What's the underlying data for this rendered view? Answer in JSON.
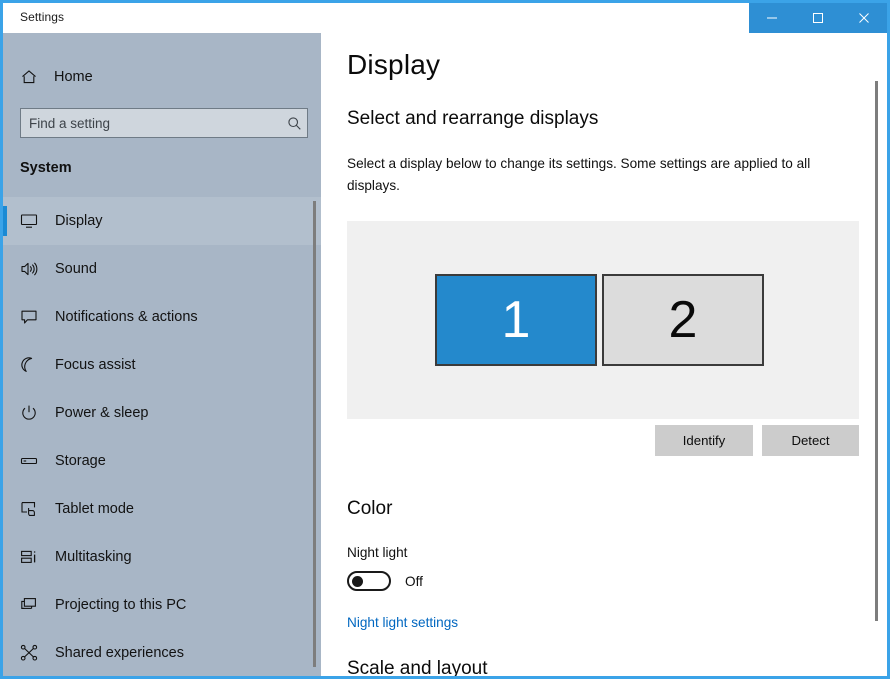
{
  "window": {
    "title": "Settings",
    "accent_color": "#3ba3e8",
    "titlebar_button_bg": "#2e8fd4",
    "controls": [
      {
        "name": "minimize",
        "glyph": "minimize-icon"
      },
      {
        "name": "maximize",
        "glyph": "maximize-icon"
      },
      {
        "name": "close",
        "glyph": "close-icon"
      }
    ]
  },
  "sidebar": {
    "background_color": "#a8b6c6",
    "home": {
      "label": "Home",
      "icon": "home-icon"
    },
    "search": {
      "value": "",
      "placeholder": "Find a setting",
      "icon": "search-icon"
    },
    "section_title": "System",
    "selected_index": 0,
    "selection_color": "#1b8ad4",
    "items": [
      {
        "label": "Display",
        "icon": "monitor-icon",
        "selected": true
      },
      {
        "label": "Sound",
        "icon": "speaker-icon",
        "selected": false
      },
      {
        "label": "Notifications & actions",
        "icon": "notification-icon",
        "selected": false
      },
      {
        "label": "Focus assist",
        "icon": "moon-icon",
        "selected": false
      },
      {
        "label": "Power & sleep",
        "icon": "power-icon",
        "selected": false
      },
      {
        "label": "Storage",
        "icon": "drive-icon",
        "selected": false
      },
      {
        "label": "Tablet mode",
        "icon": "tablet-icon",
        "selected": false
      },
      {
        "label": "Multitasking",
        "icon": "multitasking-icon",
        "selected": false
      },
      {
        "label": "Projecting to this PC",
        "icon": "projecting-icon",
        "selected": false
      },
      {
        "label": "Shared experiences",
        "icon": "share-icon",
        "selected": false
      }
    ]
  },
  "main": {
    "page_title": "Display",
    "section_select": {
      "heading": "Select and rearrange displays",
      "description": "Select a display below to change its settings. Some settings are applied to all displays.",
      "canvas_bg": "#f0f0f0",
      "displays": [
        {
          "number": "1",
          "selected": true,
          "fill": "#2489cc",
          "text_color": "#ffffff"
        },
        {
          "number": "2",
          "selected": false,
          "fill": "#dcdcdc",
          "text_color": "#0a0a0a"
        }
      ],
      "buttons": [
        {
          "label": "Identify",
          "name": "identify"
        },
        {
          "label": "Detect",
          "name": "detect"
        }
      ]
    },
    "section_color": {
      "heading": "Color",
      "nightlight_label": "Night light",
      "nightlight_state": "Off",
      "nightlight_on": false,
      "link_label": "Night light settings",
      "link_color": "#0067c0"
    },
    "section_scale": {
      "heading": "Scale and layout"
    }
  }
}
